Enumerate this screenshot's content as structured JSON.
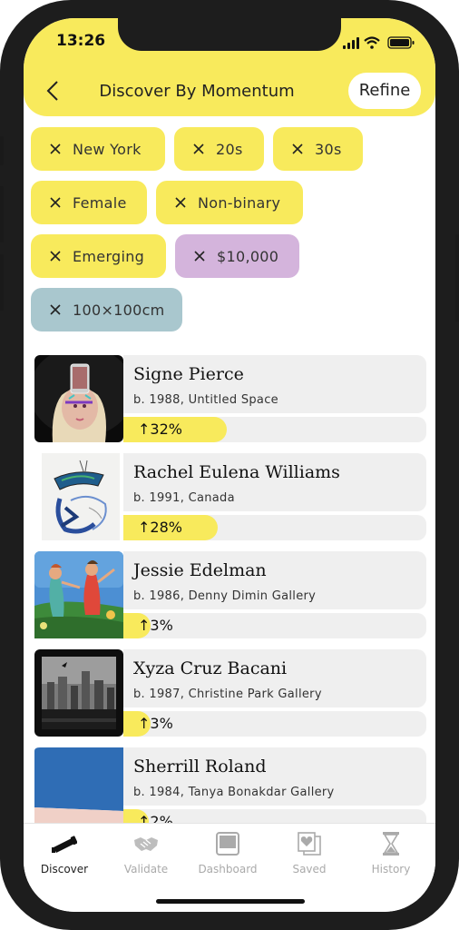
{
  "status": {
    "time": "13:26"
  },
  "header": {
    "title": "Discover By Momentum",
    "refine_label": "Refine"
  },
  "filters": [
    {
      "label": "New York",
      "color": "#f8ea5c"
    },
    {
      "label": "20s",
      "color": "#f8ea5c"
    },
    {
      "label": "30s",
      "color": "#f8ea5c"
    },
    {
      "label": "Female",
      "color": "#f8ea5c"
    },
    {
      "label": "Non-binary",
      "color": "#f8ea5c"
    },
    {
      "label": "Emerging",
      "color": "#f8ea5c"
    },
    {
      "label": "$10,000",
      "color": "#d4b4dc"
    },
    {
      "label": "100×100cm",
      "color": "#a9c7ce"
    }
  ],
  "artists": [
    {
      "name": "Signe Pierce",
      "info": "b. 1988, Untitled Space",
      "momentum": "↑32%",
      "momentum_value": 32
    },
    {
      "name": "Rachel Eulena Williams",
      "info": "b. 1991, Canada",
      "momentum": "↑28%",
      "momentum_value": 28
    },
    {
      "name": "Jessie Edelman",
      "info": "b. 1986, Denny Dimin Gallery",
      "momentum": "↑3%",
      "momentum_value": 3
    },
    {
      "name": "Xyza Cruz Bacani",
      "info": "b. 1987, Christine Park Gallery",
      "momentum": "↑3%",
      "momentum_value": 3
    },
    {
      "name": "Sherrill Roland",
      "info": "b. 1984, Tanya Bonakdar Gallery",
      "momentum": "↑2%",
      "momentum_value": 2
    }
  ],
  "tabs": [
    {
      "label": "Discover",
      "icon": "telescope-icon",
      "active": true
    },
    {
      "label": "Validate",
      "icon": "handshake-icon",
      "active": false
    },
    {
      "label": "Dashboard",
      "icon": "dashboard-icon",
      "active": false
    },
    {
      "label": "Saved",
      "icon": "saved-hearts-icon",
      "active": false
    },
    {
      "label": "History",
      "icon": "hourglass-icon",
      "active": false
    }
  ],
  "colors": {
    "accent": "#f8ea5c",
    "price_chip": "#d4b4dc",
    "size_chip": "#a9c7ce"
  }
}
